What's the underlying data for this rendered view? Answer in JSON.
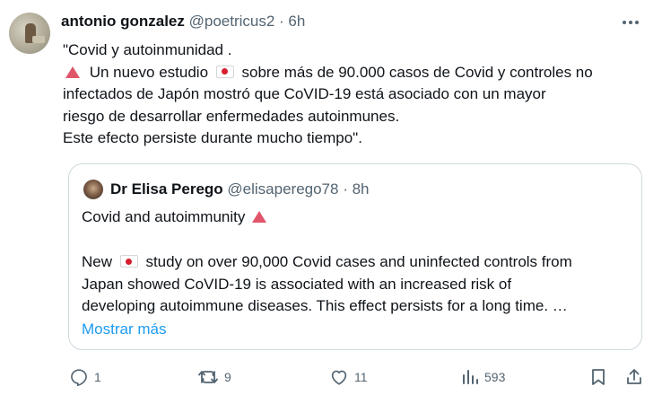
{
  "tweet": {
    "author_name": "antonio gonzalez",
    "handle_time": "@poetricus2 · 6h",
    "lines": [
      "\"Covid y autoinmunidad .",
      " Un nuevo estudio ",
      " sobre más de 90.000 casos de Covid y controles no",
      "infectados de Japón mostró que CoVID-19 está asociado con un mayor",
      "riesgo de desarrollar enfermedades autoinmunes.",
      "Este efecto persiste durante mucho tiempo\"."
    ]
  },
  "quote": {
    "author_name": "Dr Elisa Perego",
    "handle_time": "@elisaperego78 · 8h",
    "title": "Covid and autoimmunity ",
    "body_lines": [
      "New ",
      " study on over 90,000 Covid cases and uninfected controls from",
      "Japan showed CoVID-19 is associated with an increased risk of",
      "developing autoimmune diseases. This effect persists for a long time. …"
    ],
    "show_more": "Mostrar más"
  },
  "actions": {
    "replies": "1",
    "retweets": "9",
    "likes": "11",
    "views": "593"
  },
  "icons": [
    "more-icon",
    "reply-icon",
    "retweet-icon",
    "like-icon",
    "views-icon",
    "bookmark-icon",
    "share-icon",
    "warning-triangle-icon",
    "japan-flag-icon"
  ]
}
